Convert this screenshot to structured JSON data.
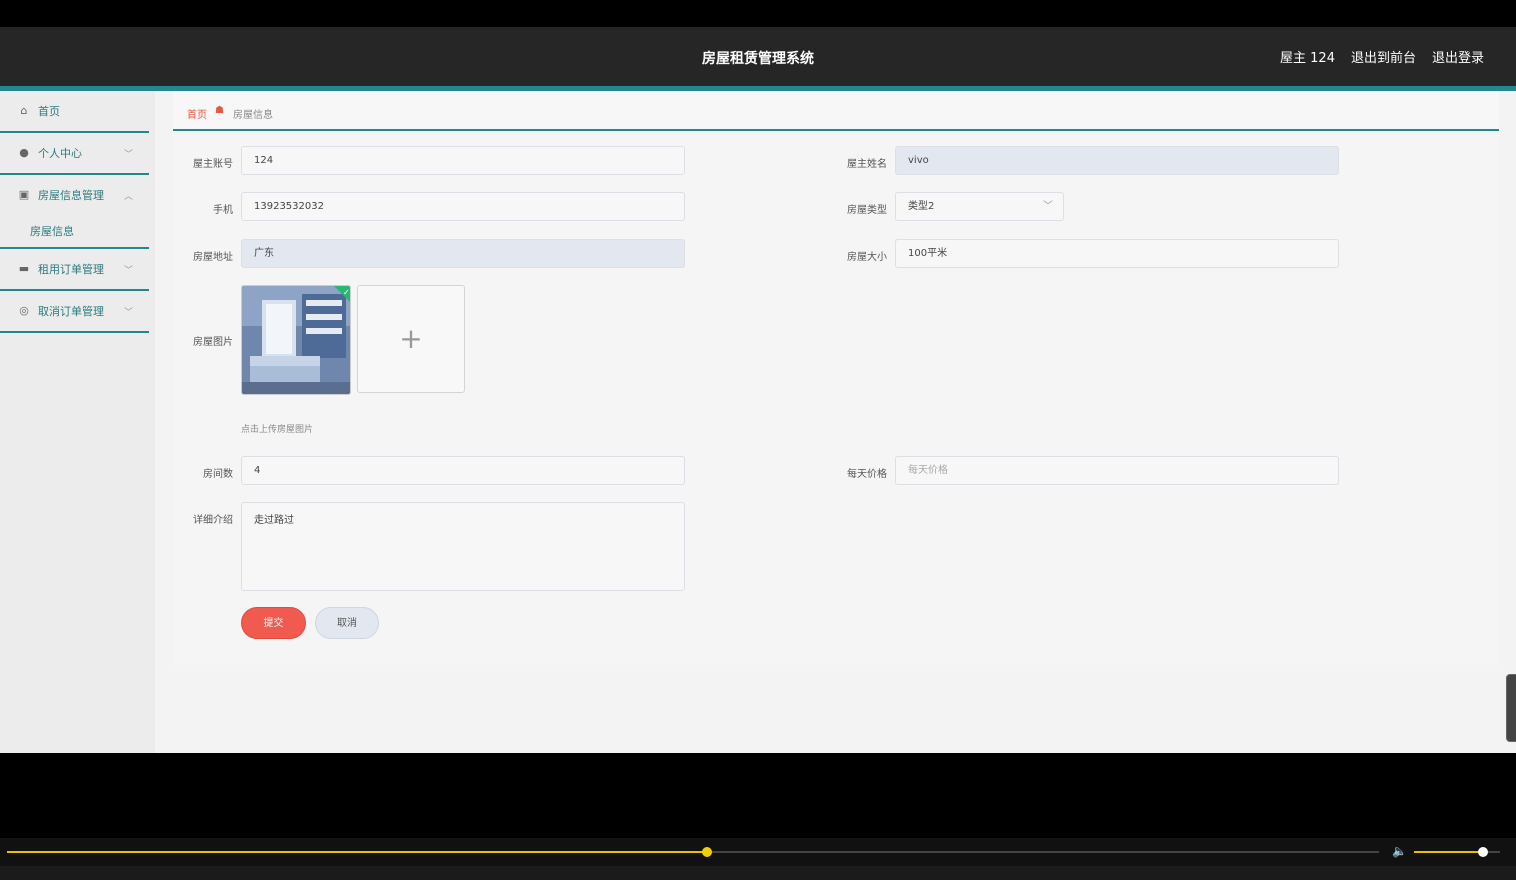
{
  "header": {
    "title": "房屋租赁管理系统",
    "user_label": "屋主 124",
    "back_to_front": "退出到前台",
    "logout": "退出登录"
  },
  "sidebar": {
    "items": [
      {
        "label": "首页",
        "icon": "home-icon"
      },
      {
        "label": "个人中心",
        "icon": "user-icon"
      },
      {
        "label": "房屋信息管理",
        "icon": "clipboard-icon"
      },
      {
        "label": "租用订单管理",
        "icon": "chat-icon"
      },
      {
        "label": "取消订单管理",
        "icon": "circle-icon"
      }
    ],
    "submenu_label": "房屋信息"
  },
  "breadcrumb": {
    "home": "首页",
    "current": "房屋信息"
  },
  "form": {
    "owner_account_label": "屋主账号",
    "owner_account_value": "124",
    "owner_name_label": "屋主姓名",
    "owner_name_value": "vivo",
    "phone_label": "手机",
    "phone_value": "13923532032",
    "house_type_label": "房屋类型",
    "house_type_value": "类型2",
    "address_label": "房屋地址",
    "address_value": "广东",
    "size_label": "房屋大小",
    "size_value": "100平米",
    "image_label": "房屋图片",
    "upload_hint": "点击上传房屋图片",
    "rooms_label": "房间数",
    "rooms_value": "4",
    "price_label": "每天价格",
    "price_placeholder": "每天价格",
    "detail_label": "详细介绍",
    "detail_value": "走过路过",
    "submit_label": "提交",
    "cancel_label": "取消"
  },
  "colors": {
    "accent": "#25878e",
    "topbar": "#262626",
    "primary_button": "#f05a4f",
    "player_progress": "#e6c200"
  },
  "player": {
    "progress": 0.51,
    "volume": 0.8
  }
}
